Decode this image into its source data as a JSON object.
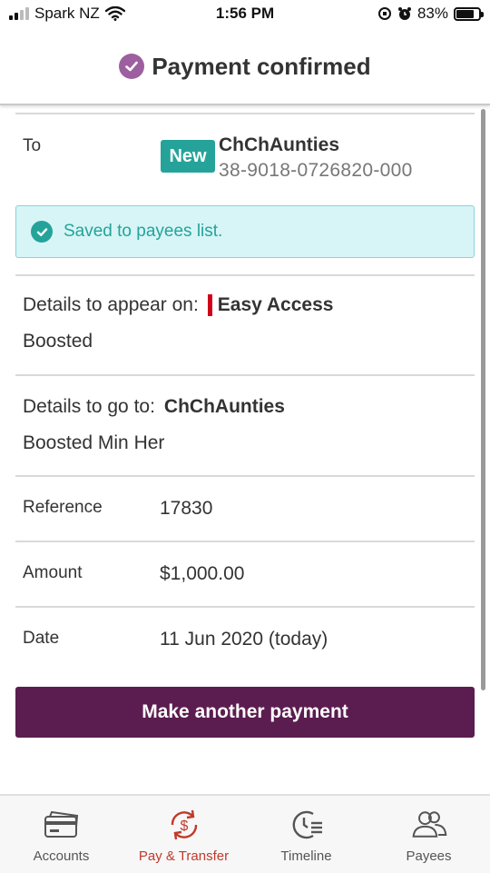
{
  "status_bar": {
    "carrier": "Spark NZ",
    "time": "1:56 PM",
    "battery": "83%"
  },
  "header": {
    "title": "Payment confirmed"
  },
  "recipient": {
    "label": "To",
    "badge": "New",
    "name": "ChChAunties",
    "account": "38-9018-0726820-000"
  },
  "saved_message": "Saved to payees list.",
  "details_appear_on": {
    "label": "Details to appear on:",
    "account": "Easy Access",
    "text": "Boosted"
  },
  "details_go_to": {
    "label": "Details to go to:",
    "payee": "ChChAunties",
    "text": "Boosted Min Her"
  },
  "reference": {
    "label": "Reference",
    "value": "17830"
  },
  "amount": {
    "label": "Amount",
    "value": "$1,000.00"
  },
  "date": {
    "label": "Date",
    "value": "11 Jun 2020 (today)"
  },
  "primary_action": "Make another payment",
  "tabs": [
    {
      "label": "Accounts",
      "icon": "card-icon",
      "active": false
    },
    {
      "label": "Pay & Transfer",
      "icon": "pay-transfer-icon",
      "active": true
    },
    {
      "label": "Timeline",
      "icon": "timeline-icon",
      "active": false
    },
    {
      "label": "Payees",
      "icon": "payees-icon",
      "active": false
    }
  ],
  "colors": {
    "brand_purple": "#5b1d4f",
    "confirm_purple": "#9d5fa0",
    "teal": "#25a39a",
    "active_tab": "#c0392b",
    "account_marker": "#d0021b"
  }
}
